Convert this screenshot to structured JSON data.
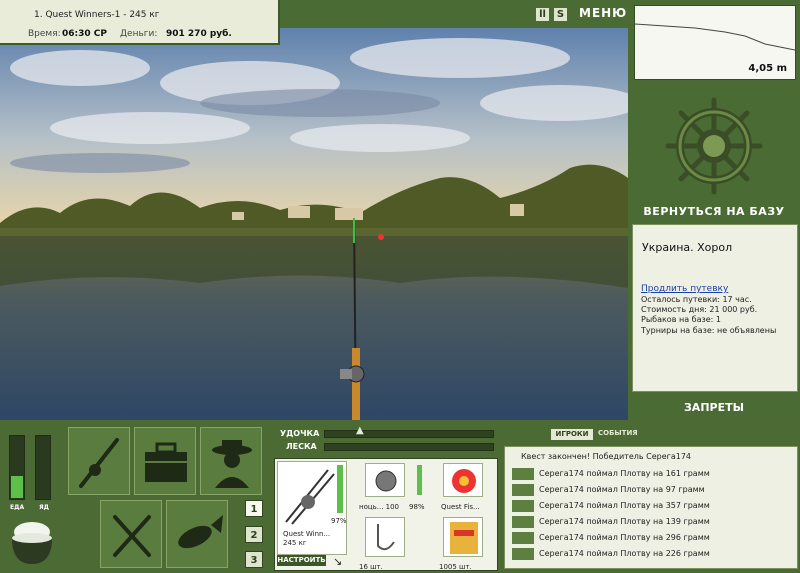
{
  "header": {
    "quest_line": "1. Quest Winners-1 - 245 кг",
    "time_label": "Время:",
    "time_value": "06:30 СР",
    "money_label": "Деньги:",
    "money_value": "901 270 руб.",
    "pause_icon": "pause-icon",
    "sound_icon": "sound-icon",
    "menu_label": "МЕНЮ"
  },
  "depth": {
    "value": "4,05 m"
  },
  "right_panel": {
    "back_label": "ВЕРНУТЬСЯ НА БАЗУ",
    "location": "Украина. Хорол",
    "extend_link": "Продлить путевку",
    "remaining": "Осталось путевки: 17 час.",
    "day_cost": "Стоимость дня: 21 000 руб.",
    "anglers": "Рыбаков на базе: 1",
    "tournaments": "Турниры на базе: не объявлены",
    "bans_label": "ЗАПРЕТЫ"
  },
  "status": {
    "food_label": "ЕДА",
    "poison_label": "ЯД",
    "food_level": 0.35,
    "poison_level": 0.0
  },
  "tools": {
    "page_buttons": [
      "1",
      "2",
      "3"
    ],
    "active_page": "1"
  },
  "tackle": {
    "rod_label": "УДОЧКА",
    "line_label": "ЛЕСКА",
    "rod_name": "Quest Winn...",
    "rod_weight": "245 кг",
    "rod_percent": "97%",
    "reel_text": "ноць... 100",
    "reel_percent": "98%",
    "line_name": "Quest Fis...",
    "hook_text": "16 шт.",
    "bait_text": "1005 шт.",
    "setup_button": "НАСТРОИТЬ"
  },
  "events": {
    "tab_players": "ИГРОКИ",
    "tab_events": "СОБЫТИЯ",
    "items": [
      "Квест закончен! Победитель Серега174",
      "Серега174 поймал Плотву на 161 грамм",
      "Серега174 поймал Плотву на 97 грамм",
      "Серега174 поймал Плотву на 357 грамм",
      "Серега174 поймал Плотву на 139 грамм",
      "Серега174 поймал Плотву на 296 грамм",
      "Серега174 поймал Плотву на 226 грамм"
    ]
  },
  "colors": {
    "panel": "#4a6b33",
    "card": "#eef0e3",
    "gauge_fill": "#5cc04a"
  }
}
